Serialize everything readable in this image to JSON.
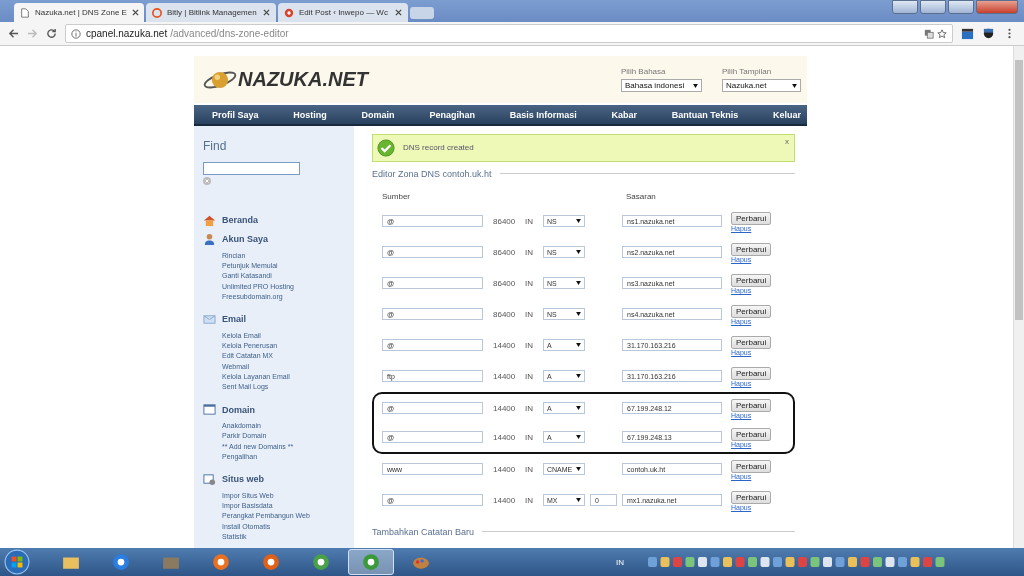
{
  "browser": {
    "tabs": [
      {
        "title": "Nazuka.net | DNS Zone E",
        "kind": "page",
        "selected": true
      },
      {
        "title": "Bitly | Bitlink Managemen",
        "kind": "bitly",
        "selected": false
      },
      {
        "title": "Edit Post ‹ Inwepo — Wc",
        "kind": "wp",
        "selected": false
      }
    ],
    "url_host": "cpanel.nazuka.net",
    "url_path": "/advanced/dns-zone-editor"
  },
  "header": {
    "logo": "NAZUKA.NET",
    "language": {
      "label": "Pilih Bahasa",
      "value": "Bahasa indonesi"
    },
    "theme": {
      "label": "Pilih Tampilan",
      "value": "Nazuka.net"
    }
  },
  "nav": [
    "Profil Saya",
    "Hosting",
    "Domain",
    "Penagihan",
    "Basis Informasi",
    "Kabar",
    "Bantuan Teknis",
    "Keluar"
  ],
  "sidebar": {
    "find_title": "Find",
    "sections": [
      {
        "title": "Beranda",
        "kind": "home"
      },
      {
        "title": "Akun Saya",
        "kind": "user",
        "items": [
          "Rincian",
          "Petunjuk Memulai",
          "Ganti Katasandi",
          "Unlimited PRO Hosting",
          "Freesubdomain.org"
        ]
      },
      {
        "title": "Email",
        "kind": "email",
        "items": [
          "Kelola Email",
          "Kelola Penerusan",
          "Edit Catatan MX",
          "Webmail",
          "Kelola Layanan Email",
          "Sent Mail Logs"
        ]
      },
      {
        "title": "Domain",
        "kind": "domain",
        "items": [
          "Anakdomain",
          "Parkir Domain",
          "** Add new Domains **",
          "Pengalihan"
        ]
      },
      {
        "title": "Situs web",
        "kind": "web",
        "items": [
          "Impor Situs Web",
          "Impor Basisdata",
          "Perangkat Pembangun Web",
          "Install Otomatis",
          "Statistik"
        ]
      }
    ]
  },
  "alert": {
    "message": "DNS record created",
    "close": "x"
  },
  "editor": {
    "title": "Editor Zona DNS contoh.uk.ht",
    "col_source": "Sumber",
    "col_target": "Sasaran",
    "records": [
      {
        "source": "@",
        "ttl": "86400",
        "class": "IN",
        "type": "NS",
        "target": "ns1.nazuka.net",
        "button": "Perbarui",
        "link": "Hapus",
        "highlighted": false
      },
      {
        "source": "@",
        "ttl": "86400",
        "class": "IN",
        "type": "NS",
        "target": "ns2.nazuka.net",
        "button": "Perbarui",
        "link": "Hapus",
        "highlighted": false
      },
      {
        "source": "@",
        "ttl": "86400",
        "class": "IN",
        "type": "NS",
        "target": "ns3.nazuka.net",
        "button": "Perbarui",
        "link": "Hapus",
        "highlighted": false
      },
      {
        "source": "@",
        "ttl": "86400",
        "class": "IN",
        "type": "NS",
        "target": "ns4.nazuka.net",
        "button": "Perbarui",
        "link": "Hapus",
        "highlighted": false
      },
      {
        "source": "@",
        "ttl": "14400",
        "class": "IN",
        "type": "A",
        "target": "31.170.163.216",
        "button": "Perbarui",
        "link": "Hapus",
        "highlighted": false
      },
      {
        "source": "ftp",
        "ttl": "14400",
        "class": "IN",
        "type": "A",
        "target": "31.170.163.216",
        "button": "Perbarui",
        "link": "Hapus",
        "highlighted": false
      },
      {
        "source": "@",
        "ttl": "14400",
        "class": "IN",
        "type": "A",
        "target": "67.199.248.12",
        "button": "Perbarui",
        "link": "Hapus",
        "highlighted": true
      },
      {
        "source": "@",
        "ttl": "14400",
        "class": "IN",
        "type": "A",
        "target": "67.199.248.13",
        "button": "Perbarui",
        "link": "Hapus",
        "highlighted": true
      },
      {
        "source": "www",
        "ttl": "14400",
        "class": "IN",
        "type": "CNAME",
        "target": "contoh.uk.ht",
        "button": "Perbarui",
        "link": "Hapus",
        "highlighted": false
      },
      {
        "source": "@",
        "ttl": "14400",
        "class": "IN",
        "type": "MX",
        "priority": "0",
        "target": "mx1.nazuka.net",
        "button": "Perbarui",
        "link": "Hapus",
        "highlighted": false
      }
    ]
  },
  "add_title": "Tambahkan Catatan Baru",
  "taskbar": {
    "apps": [
      {
        "kind": "folder",
        "selected": false
      },
      {
        "kind": "ie",
        "selected": false
      },
      {
        "kind": "box",
        "selected": false
      },
      {
        "kind": "player",
        "selected": false
      },
      {
        "kind": "firefox",
        "selected": false
      },
      {
        "kind": "people",
        "selected": false
      },
      {
        "kind": "chrome",
        "selected": true
      },
      {
        "kind": "paint",
        "selected": false
      }
    ],
    "language": "IN"
  }
}
